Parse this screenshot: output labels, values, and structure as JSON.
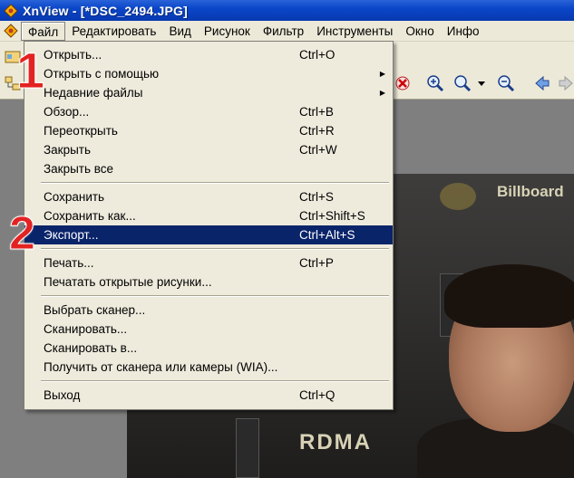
{
  "window": {
    "title": "XnView - [*DSC_2494.JPG]"
  },
  "menubar": {
    "items": [
      "Файл",
      "Редактировать",
      "Вид",
      "Рисунок",
      "Фильтр",
      "Инструменты",
      "Окно",
      "Инфо"
    ]
  },
  "file_menu": {
    "items": [
      {
        "label": "Открыть...",
        "shortcut": "Ctrl+O"
      },
      {
        "label": "Открыть с помощью",
        "shortcut": ""
      },
      {
        "label": "Недавние файлы",
        "shortcut": ""
      },
      {
        "label": "Обзор...",
        "shortcut": "Ctrl+B"
      },
      {
        "label": "Переоткрыть",
        "shortcut": "Ctrl+R"
      },
      {
        "label": "Закрыть",
        "shortcut": "Ctrl+W"
      },
      {
        "label": "Закрыть все",
        "shortcut": ""
      },
      {
        "label": "Сохранить",
        "shortcut": "Ctrl+S"
      },
      {
        "label": "Сохранить как...",
        "shortcut": "Ctrl+Shift+S"
      },
      {
        "label": "Экспорт...",
        "shortcut": "Ctrl+Alt+S"
      },
      {
        "label": "Печать...",
        "shortcut": "Ctrl+P"
      },
      {
        "label": "Печатать открытые рисунки...",
        "shortcut": ""
      },
      {
        "label": "Выбрать сканер...",
        "shortcut": ""
      },
      {
        "label": "Сканировать...",
        "shortcut": ""
      },
      {
        "label": "Сканировать в...",
        "shortcut": ""
      },
      {
        "label": "Получить от сканера или камеры (WIA)...",
        "shortcut": ""
      },
      {
        "label": "Выход",
        "shortcut": "Ctrl+Q"
      }
    ],
    "highlighted": "Экспорт..."
  },
  "annotations": {
    "step1": "1",
    "step2": "2"
  },
  "photo_text": {
    "brand": "Billboard",
    "brand2": "RDMA"
  },
  "colors": {
    "highlight": "#0a246a",
    "step_marker": "#e32222",
    "titlebar": "#0a46c9"
  }
}
